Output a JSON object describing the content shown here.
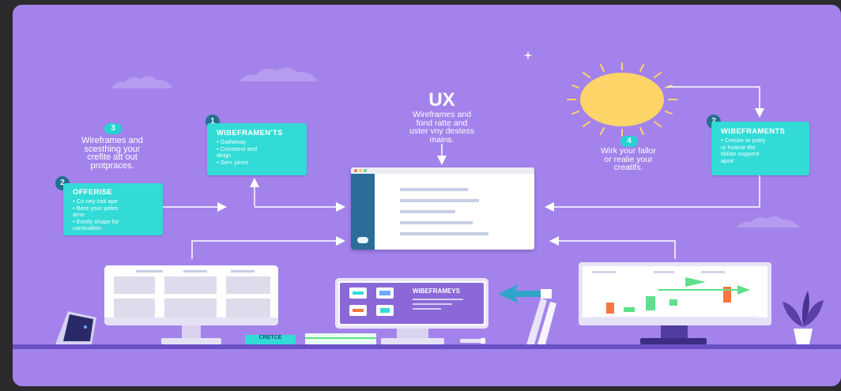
{
  "center": {
    "title": "UX",
    "subtitle": [
      "Wireframes and",
      "fond ratte and",
      "uster vny destess",
      "mains."
    ]
  },
  "left_note": {
    "badge": "3",
    "lines": [
      "Wireframes and",
      "scesthing your",
      "crefite att out",
      "protpraces."
    ]
  },
  "sun_note": {
    "badge": "4",
    "lines": [
      "Wirk your fallor",
      "or realie your",
      "creatifs."
    ]
  },
  "card_wireframents": {
    "badge": "1",
    "title": "WIBEFRAMEN'TS",
    "items": [
      "• Gathenay",
      "• Conseest and",
      "  deign",
      "• Set+ pince"
    ]
  },
  "card_offerise": {
    "badge": "2",
    "title": "OFFERISE",
    "items": [
      "• Co ney cait ape",
      "• Bere your peles",
      "  arne",
      "• Eestly shape for",
      "  camicatlon"
    ]
  },
  "card_right": {
    "badge": "2",
    "title": "WIBEFRAMENTS",
    "items": [
      "• Cresire or potry",
      "  ur hvame the",
      "  tibilan suppent",
      "  apoir"
    ]
  },
  "tablet_label": "WIBEFRAMEYS",
  "book_label": "CRETCE",
  "colors": {
    "background": "#a383eb",
    "card": "#33dbd7",
    "sun": "#fcd468",
    "window_sidebar": "#2b6d98",
    "chart_green": "#5ee08a",
    "chart_orange": "#f4773f",
    "shelf": "#6b4fc7",
    "plant": "#5b3fa6"
  }
}
